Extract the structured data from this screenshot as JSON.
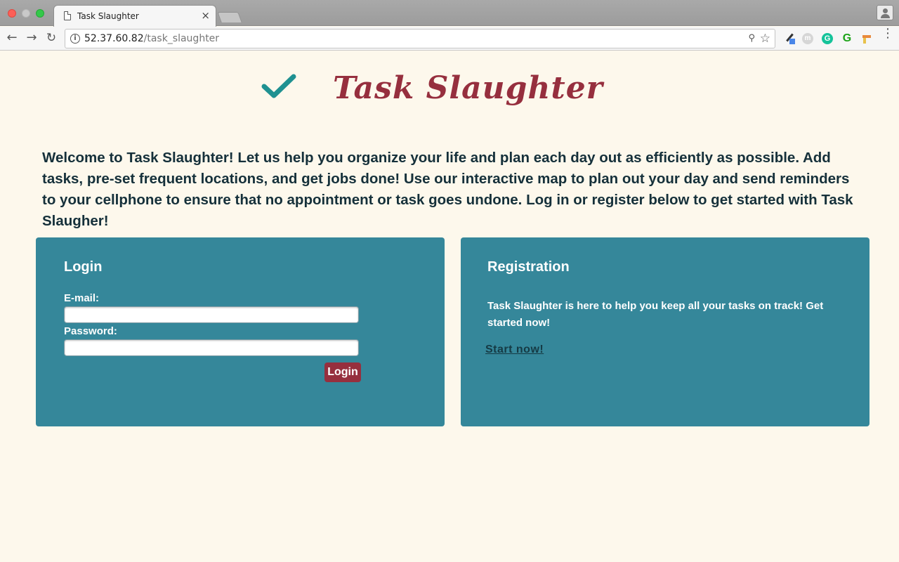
{
  "browser": {
    "tab_title": "Task Slaughter",
    "tab_close": "×",
    "url_host": "52.37.60.82",
    "url_path": "/task_slaughter"
  },
  "header": {
    "title": "Task Slaughter"
  },
  "intro": {
    "text": "Welcome to Task Slaughter! Let us help you organize your life and plan each day out as efficiently as possible. Add tasks, pre-set frequent locations, and get jobs done! Use our interactive map to plan out your day and send reminders to your cellphone to ensure that no appointment or task goes undone. Log in or register below to get started with Task Slaugher!"
  },
  "login": {
    "heading": "Login",
    "email_label": "E-mail:",
    "email_value": "",
    "password_label": "Password:",
    "password_value": "",
    "button_label": "Login"
  },
  "registration": {
    "heading": "Registration",
    "text": "Task Slaughter is here to help you keep all your tasks on track! Get started now!",
    "link_label": "Start now!"
  },
  "colors": {
    "page_bg": "#fdf8ec",
    "panel_bg": "#35879a",
    "brand_red": "#962f3e",
    "check_teal": "#1f9191",
    "text_dark": "#15303a"
  },
  "icons": {
    "logo": "checkmark-icon",
    "nav": [
      "back-arrow-icon",
      "forward-arrow-icon",
      "reload-icon"
    ],
    "omnibox": [
      "info-icon",
      "key-icon",
      "star-icon"
    ],
    "extensions": [
      "color-picker-icon",
      "m-extension-icon",
      "grammarly-icon",
      "g-extension-icon",
      "paint-extension-icon",
      "menu-icon"
    ]
  }
}
